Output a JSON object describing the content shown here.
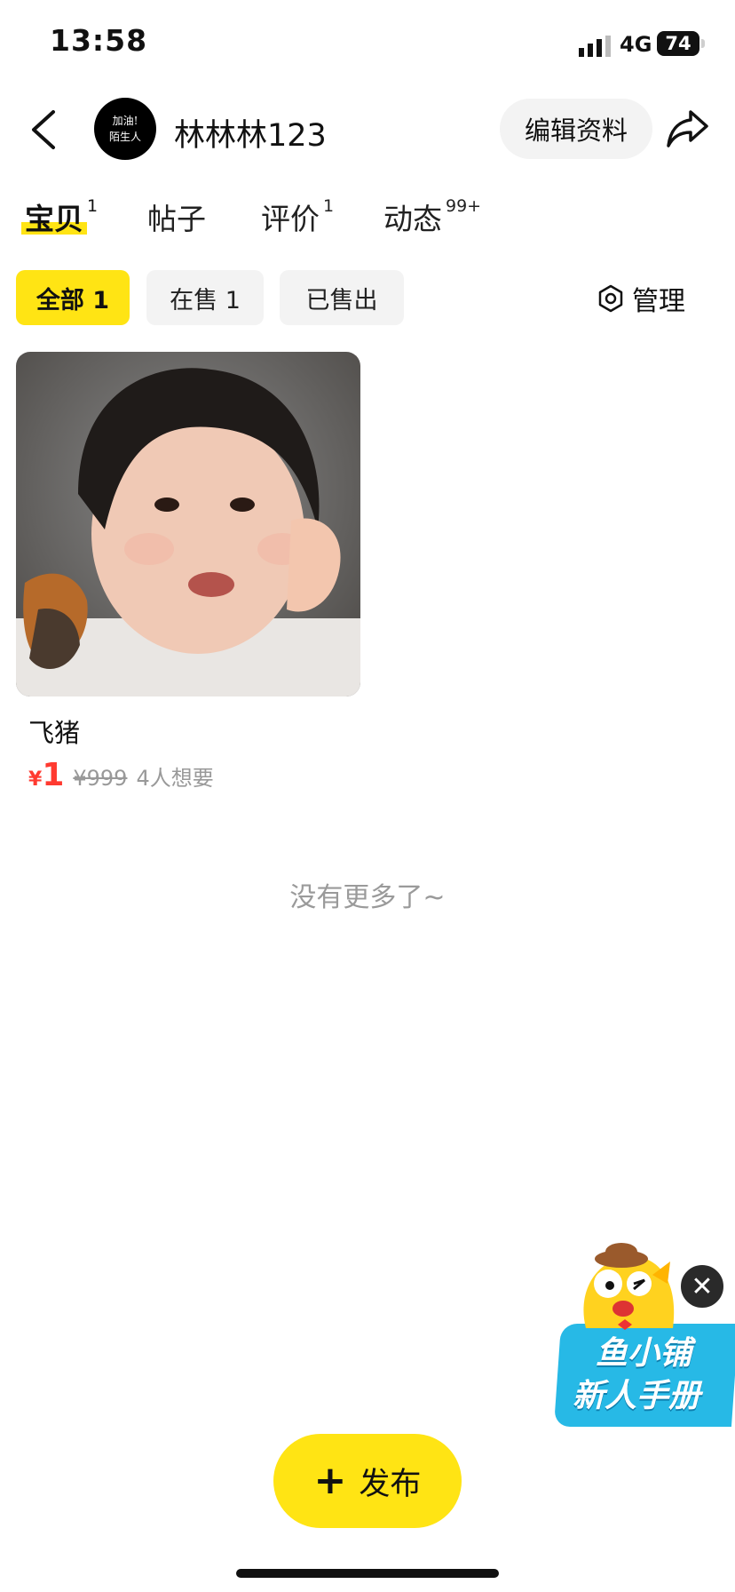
{
  "status_bar": {
    "time": "13:58",
    "network": "4G",
    "battery": "74"
  },
  "header": {
    "avatar_text_line1": "加油!",
    "avatar_text_line2": "陌生人",
    "username": "林林林123",
    "edit_profile_label": "编辑资料"
  },
  "tabs": [
    {
      "label": "宝贝",
      "badge": "1"
    },
    {
      "label": "帖子",
      "badge": ""
    },
    {
      "label": "评价",
      "badge": "1"
    },
    {
      "label": "动态",
      "badge": "99+"
    }
  ],
  "filters": [
    {
      "label": "全部 1"
    },
    {
      "label": "在售 1"
    },
    {
      "label": "已售出"
    }
  ],
  "manage_label": "管理",
  "products": [
    {
      "title": "飞猪",
      "price_symbol": "¥",
      "price": "1",
      "original_price": "¥999",
      "want_count": "4人想要"
    }
  ],
  "no_more_text": "没有更多了~",
  "promo": {
    "line1": "鱼小铺",
    "line2": "新人手册"
  },
  "publish_label": "发布",
  "colors": {
    "accent": "#ffe414",
    "price": "#ff3a30",
    "promo": "#27b9e6"
  }
}
